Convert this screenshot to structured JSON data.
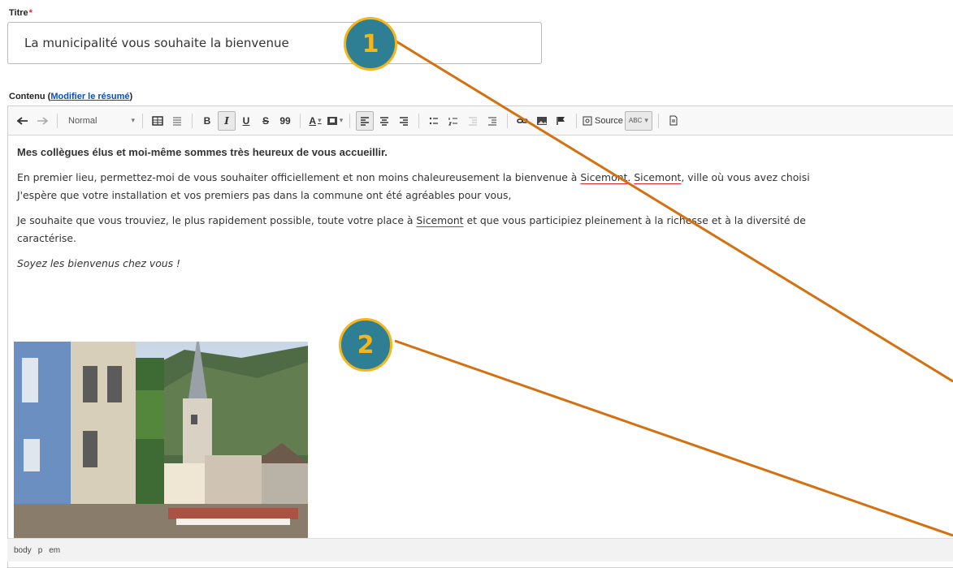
{
  "title_field": {
    "label": "Titre",
    "required_mark": "*",
    "value": "La municipalité vous souhaite la bienvenue"
  },
  "content_field": {
    "label": "Contenu (",
    "link": "Modifier le résumé",
    "label_end": ")"
  },
  "toolbar": {
    "format": "Normal",
    "bold": "B",
    "italic": "I",
    "underline": "U",
    "strike": "S",
    "quote": "99",
    "text_color": "A",
    "source": "Source",
    "spell": "ABC"
  },
  "content": {
    "heading": "Mes collègues élus et moi-même sommes très heureux de vous accueillir.",
    "p1a": "En premier lieu, permettez-moi de vous souhaiter officiellement et non moins chaleureusement la bienvenue à ",
    "p1b": "Sicemont",
    "p1c": ". ",
    "p1d": "Sicemont",
    "p1e": ", ville où vous avez choisi",
    "p1_line2": "J'espère que votre installation et vos premiers pas dans la commune ont été agréables pour vous,",
    "p2a": "Je souhaite que vous trouviez, le plus rapidement possible, toute votre place à ",
    "p2b": "Sicemont",
    "p2c": " et que vous participiez pleinement à la richesse et à la diversité de",
    "p2_line2": "caractérise.",
    "p3": "Soyez les bienvenus chez vous !"
  },
  "statusbar": [
    "body",
    "p",
    "em"
  ],
  "callouts": [
    "1",
    "2"
  ],
  "colors": {
    "accent_link": "#0b4db8",
    "required": "#e0262f",
    "badge_fill": "#2e7f93",
    "badge_ring": "#f5b51b",
    "arrow": "#d4700e"
  },
  "icons": [
    "undo-icon",
    "redo-icon",
    "table-icon",
    "hr-icon",
    "bold-icon",
    "italic-icon",
    "underline-icon",
    "strike-icon",
    "blockquote-icon",
    "text-color-icon",
    "bg-color-icon",
    "align-left-icon",
    "align-center-icon",
    "align-right-icon",
    "bulleted-list-icon",
    "numbered-list-icon",
    "outdent-icon",
    "indent-icon",
    "link-icon",
    "image-icon",
    "flag-icon",
    "source-icon",
    "spellcheck-icon",
    "template-icon"
  ]
}
